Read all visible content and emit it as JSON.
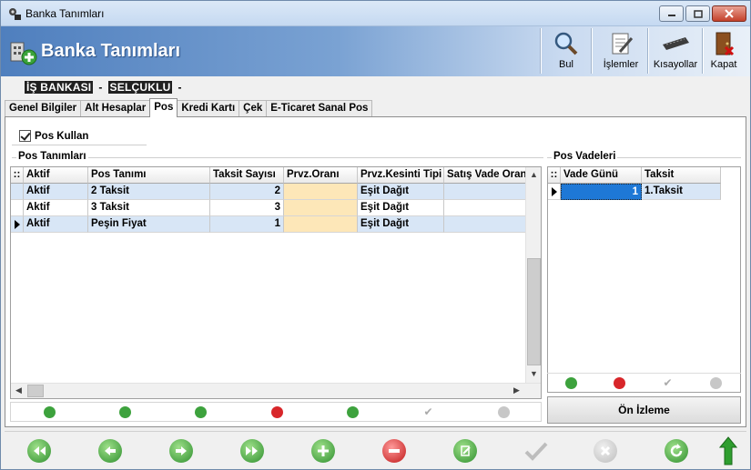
{
  "window": {
    "title": "Banka Tanımları",
    "header_title": "Banka Tanımları"
  },
  "toolbar": {
    "buttons": [
      {
        "label": "Bul",
        "icon": "magnifier-icon"
      },
      {
        "label": "İşlemler",
        "icon": "document-pen-icon"
      },
      {
        "label": "Kısayollar",
        "icon": "keyboard-icon"
      },
      {
        "label": "Kapat",
        "icon": "exit-door-icon"
      }
    ]
  },
  "bank": {
    "name": "İŞ BANKASI",
    "sep": "-",
    "branch": "SELÇUKLU",
    "sep2": "-"
  },
  "tabs": [
    "Genel Bilgiler",
    "Alt Hesaplar",
    "Pos",
    "Kredi Kartı",
    "Çek",
    "E-Ticaret Sanal Pos"
  ],
  "active_tab": "Pos",
  "pos_kullan": {
    "label": "Pos Kullan",
    "checked": true
  },
  "pos_tanimlari": {
    "title": "Pos Tanımları",
    "indicator_header": "::",
    "columns": [
      "Aktif",
      "Pos Tanımı",
      "Taksit Sayısı",
      "Prvz.Oranı",
      "Prvz.Kesinti Tipi",
      "Satış Vade Oran"
    ],
    "rows": [
      {
        "aktif": "Aktif",
        "tanim": "2 Taksit",
        "taksit": "2",
        "oran": "",
        "kesinti": "Eşit Dağıt",
        "vade": ""
      },
      {
        "aktif": "Aktif",
        "tanim": "3 Taksit",
        "taksit": "3",
        "oran": "",
        "kesinti": "Eşit Dağıt",
        "vade": ""
      },
      {
        "aktif": "Aktif",
        "tanim": "Peşin Fiyat",
        "taksit": "1",
        "oran": "",
        "kesinti": "Eşit Dağıt",
        "vade": ""
      }
    ]
  },
  "pos_vadeleri": {
    "title": "Pos Vadeleri",
    "indicator_header": "::",
    "columns": [
      "Vade Günü",
      "Taksit"
    ],
    "rows": [
      {
        "gun": "1",
        "taksit": "1.Taksit"
      }
    ]
  },
  "on_izleme": "Ön İzleme",
  "colors": {
    "header_blue": "#4f7fbe",
    "selected_row": "#d8e6f6",
    "prvz_cell": "#fde7b8",
    "active_cell": "#1e78d6"
  }
}
